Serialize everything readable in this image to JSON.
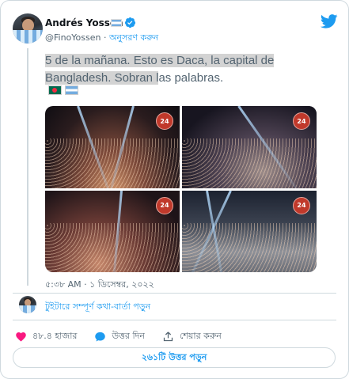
{
  "author": {
    "name": "Andrés Yossen",
    "handle": "@FinoYossen",
    "follow_label": "অনুসরণ করুন",
    "separator": "·"
  },
  "tweet": {
    "text_highlighted_1": "5 de la mañana. Esto es Daca, la capital de",
    "text_highlighted_2": "Bangladesh. Sobran l",
    "text_rest_2": "as palabras.",
    "timestamp": "৫:৩৮ AM · ১ ডিসেম্বর, ২০২২"
  },
  "media": {
    "channel_logo_text": "24"
  },
  "read_conversation_label": "টুইটারে সম্পূর্ণ কথা-বার্তা পড়ুন",
  "actions": {
    "likes_label": "৪৮.৪ হাজার",
    "reply_label": "উত্তর দিন",
    "share_label": "শেয়ার করুন"
  },
  "replies_button_label": "২৬১টি উত্তর পড়ুন",
  "colors": {
    "accent": "#1d9bf0",
    "like": "#f91880",
    "muted": "#536471",
    "border": "#cfd9de"
  },
  "icons": [
    "twitter-bird-icon",
    "verified-badge-icon",
    "heart-icon",
    "reply-bubble-icon",
    "share-icon",
    "argentina-flag-icon",
    "bangladesh-flag-icon"
  ]
}
